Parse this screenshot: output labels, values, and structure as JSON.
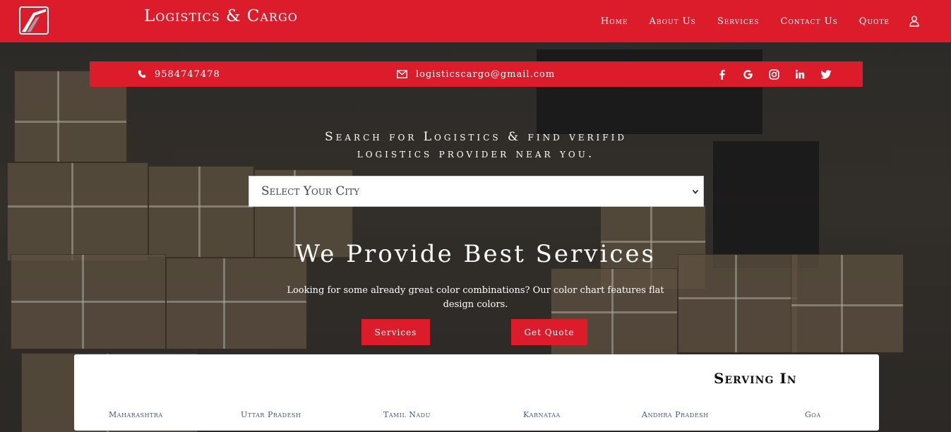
{
  "brand": {
    "name": "Logistics & Cargo",
    "logo_icon": "logo-swoosh-icon"
  },
  "nav": {
    "items": [
      "Home",
      "About Us",
      "Services",
      "Contact Us",
      "Quote"
    ],
    "user_icon": "user-icon"
  },
  "contact": {
    "phone": "9584747478",
    "email": "logisticscargo@gmail.com",
    "socials": [
      "facebook-icon",
      "google-icon",
      "instagram-icon",
      "linkedin-icon",
      "twitter-icon"
    ]
  },
  "search": {
    "heading_line1": "Search for Logistics & find verifid",
    "heading_line2": "logistics provider near you.",
    "select_value": "Select Your City"
  },
  "hero": {
    "title": "We Provide Best Services",
    "text_line1": "Looking for some already great color combinations? Our color chart features flat",
    "text_line2": "design colors.",
    "btn_services": "Services",
    "btn_quote": "Get Quote"
  },
  "serving": {
    "title": "Serving In",
    "states": [
      "Maharashtra",
      "Uttar Pradesh",
      "Tamil Nadu",
      "Karnataa",
      "Andhra Pradesh",
      "Goa"
    ]
  },
  "colors": {
    "accent": "#dc1c2b",
    "link": "#3a5a8f",
    "panel": "#ffffff"
  }
}
